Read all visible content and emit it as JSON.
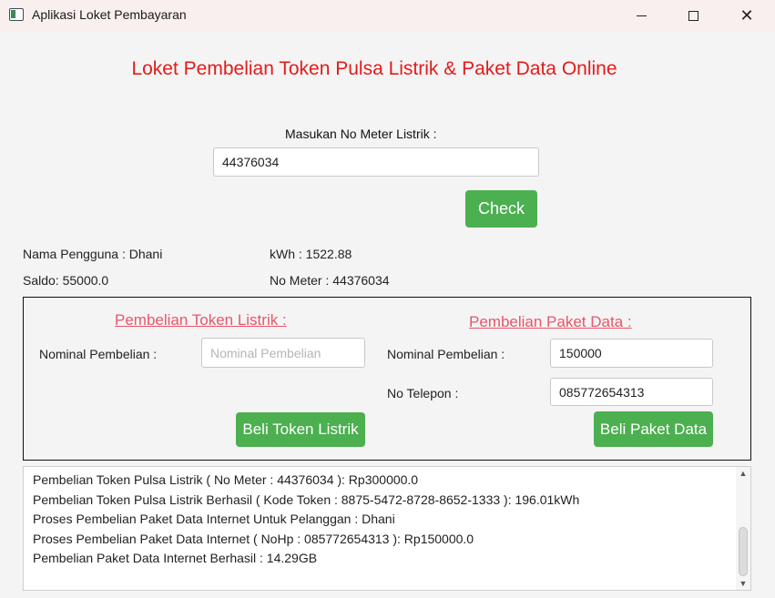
{
  "window": {
    "title": "Aplikasi Loket Pembayaran",
    "minimize_glyph": "",
    "close_glyph": "✕"
  },
  "header": {
    "title": "Loket Pembelian Token Pulsa Listrik & Paket Data Online"
  },
  "meter_lookup": {
    "label": "Masukan No Meter Listrik :",
    "value": "44376034",
    "check_label": "Check"
  },
  "customer": {
    "name_text": "Nama Pengguna : Dhani",
    "saldo_text": "Saldo: 55000.0",
    "kwh_text": "kWh : 1522.88",
    "meter_text": "No Meter : 44376034"
  },
  "token_purchase": {
    "title": "Pembelian Token Listrik :",
    "nominal_label": "Nominal Pembelian :",
    "nominal_placeholder": "Nominal Pembelian",
    "nominal_value": "",
    "buy_label": "Beli Token Listrik"
  },
  "data_purchase": {
    "title": "Pembelian Paket Data :",
    "nominal_label": "Nominal Pembelian :",
    "nominal_value": "150000",
    "phone_label": "No Telepon :",
    "phone_value": "085772654313",
    "buy_label": "Beli Paket Data"
  },
  "log": {
    "lines": [
      "Pembelian Token Pulsa Listrik ( No Meter : 44376034 ): Rp300000.0",
      "Pembelian Token Pulsa Listrik Berhasil ( Kode Token : 8875-5472-8728-8652-1333 ): 196.01kWh",
      "Proses Pembelian Paket Data Internet Untuk Pelanggan : Dhani",
      "Proses Pembelian Paket Data Internet ( NoHp : 085772654313 ): Rp150000.0",
      "Pembelian Paket Data Internet Berhasil : 14.29GB"
    ]
  },
  "colors": {
    "heading": "#e31b1b",
    "section_title": "#e8566a",
    "button": "#4caf50"
  }
}
